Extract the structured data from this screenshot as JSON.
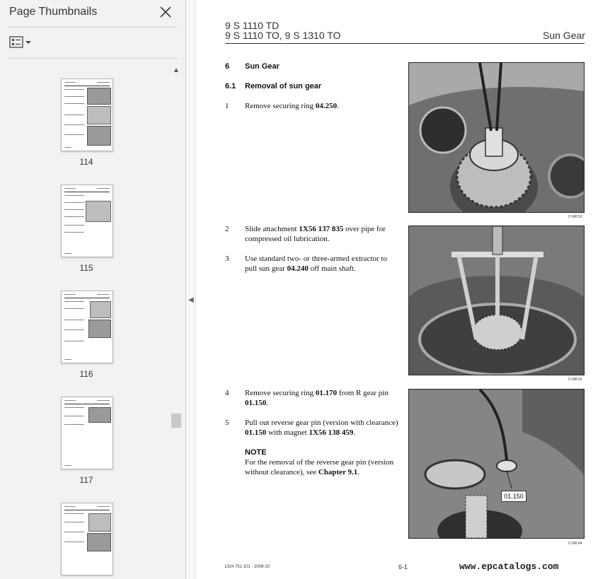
{
  "sidebar": {
    "title": "Page Thumbnails",
    "thumbnails": [
      {
        "page": "114"
      },
      {
        "page": "115"
      },
      {
        "page": "116"
      },
      {
        "page": "117"
      },
      {
        "page": ""
      }
    ]
  },
  "page": {
    "header_line1": "9 S 1110 TD",
    "header_line2": "9 S 1110 TO, 9 S 1310 TO",
    "header_right": "Sun Gear",
    "section_num": "6",
    "section_title": "Sun Gear",
    "subsection_num": "6.1",
    "subsection_title": "Removal of sun gear",
    "steps": [
      {
        "num": "1",
        "text_a": "Remove securing ring ",
        "bold_a": "04.250",
        "text_b": "."
      },
      {
        "num": "2",
        "text_a": "Slide attachment ",
        "bold_a": "1X56 137 835",
        "text_b": " over pipe for compressed oil lubrication."
      },
      {
        "num": "3",
        "text_a": "Use standard two- or three-armed extractor to pull sun gear ",
        "bold_a": "04.240",
        "text_b": " off main shaft."
      },
      {
        "num": "4",
        "text_a": "Remove securing ring ",
        "bold_a": "01.170",
        "text_b": " from R gear pin ",
        "bold_b": "01.150",
        "text_c": "."
      },
      {
        "num": "5",
        "text_a": "Pull out reverse gear pin (version with clearance) ",
        "bold_a": "01.150",
        "text_b": " with magnet ",
        "bold_b": "1X56 138 459",
        "text_c": "."
      }
    ],
    "note_heading": "NOTE",
    "note_text": "For the removal of the reverse gear pin (version without clearance), see ",
    "note_bold": "Chapter 9.1",
    "note_end": ".",
    "photo_codes": [
      "0 248 53",
      "0 248 63",
      "0 248 64"
    ],
    "callout": "01.150",
    "footer_left": "1324 751 101 - 2009-10",
    "footer_center": "6-1",
    "watermark": "www.epcatalogs.com"
  },
  "colors": {
    "sidebar_bg": "#f2f2f2",
    "page_bg": "#ffffff",
    "text": "#333333"
  },
  "icons": {
    "close": "close-icon",
    "options": "options-icon",
    "scroll_up": "scroll-up-icon",
    "collapse": "collapse-panel-icon"
  }
}
